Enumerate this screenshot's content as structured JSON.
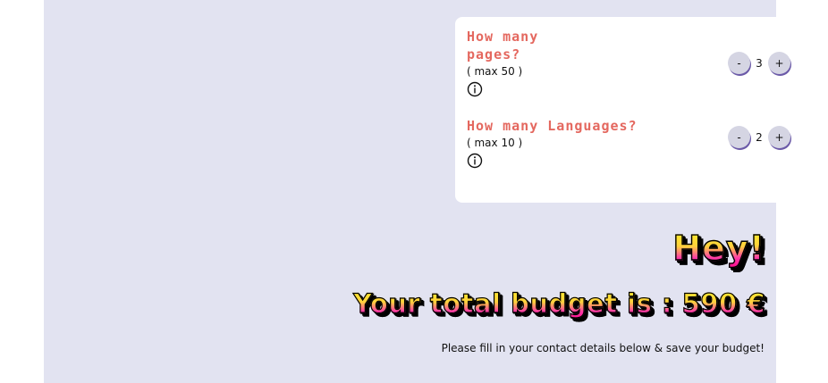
{
  "questions": [
    {
      "title": "How many pages?",
      "max": "( max 50 )",
      "value": "3"
    },
    {
      "title": "How many Languages?",
      "max": "( max 10 )",
      "value": "2"
    }
  ],
  "stepper": {
    "minus_label": "-",
    "plus_label": "+"
  },
  "hey": "Hey!",
  "budget": "Your total budget is : 590 €",
  "note": "Please fill in your contact details below & save your budget!",
  "colors": {
    "background": "#e2e3f1",
    "card": "#ffffff",
    "question_title": "#e4685f",
    "stepper_button": "#d5d5e3"
  }
}
